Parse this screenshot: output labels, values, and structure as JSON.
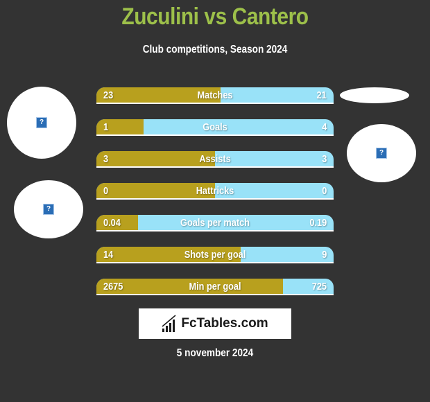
{
  "header": {
    "title": "Zuculini vs Cantero",
    "subtitle": "Club competitions, Season 2024",
    "title_color": "#9dc04a"
  },
  "colors": {
    "left_player": "#b8a01e",
    "right_player": "#99e2f8",
    "background": "#333333"
  },
  "chart_data": {
    "type": "bar",
    "orientation": "horizontal-split",
    "title": "Zuculini vs Cantero",
    "subtitle": "Club competitions, Season 2024",
    "series": [
      {
        "name": "Zuculini",
        "values": [
          23,
          1,
          3,
          0,
          0.04,
          14,
          2675
        ]
      },
      {
        "name": "Cantero",
        "values": [
          21,
          4,
          3,
          0,
          0.19,
          9,
          725
        ]
      }
    ],
    "categories": [
      "Matches",
      "Goals",
      "Assists",
      "Hattricks",
      "Goals per match",
      "Shots per goal",
      "Min per goal"
    ],
    "rows": [
      {
        "label": "Matches",
        "left": "23",
        "right": "21",
        "left_share": 0.523
      },
      {
        "label": "Goals",
        "left": "1",
        "right": "4",
        "left_share": 0.2
      },
      {
        "label": "Assists",
        "left": "3",
        "right": "3",
        "left_share": 0.5
      },
      {
        "label": "Hattricks",
        "left": "0",
        "right": "0",
        "left_share": 0.5
      },
      {
        "label": "Goals per match",
        "left": "0.04",
        "right": "0.19",
        "left_share": 0.174
      },
      {
        "label": "Shots per goal",
        "left": "14",
        "right": "9",
        "left_share": 0.609
      },
      {
        "label": "Min per goal",
        "left": "2675",
        "right": "725",
        "left_share": 0.787
      }
    ]
  },
  "logo": {
    "text": "FcTables.com",
    "icon": "bar-chart-icon"
  },
  "footer": {
    "date": "5 november 2024"
  },
  "placeholders": {
    "icon": "broken-image-icon",
    "glyph": "?"
  }
}
